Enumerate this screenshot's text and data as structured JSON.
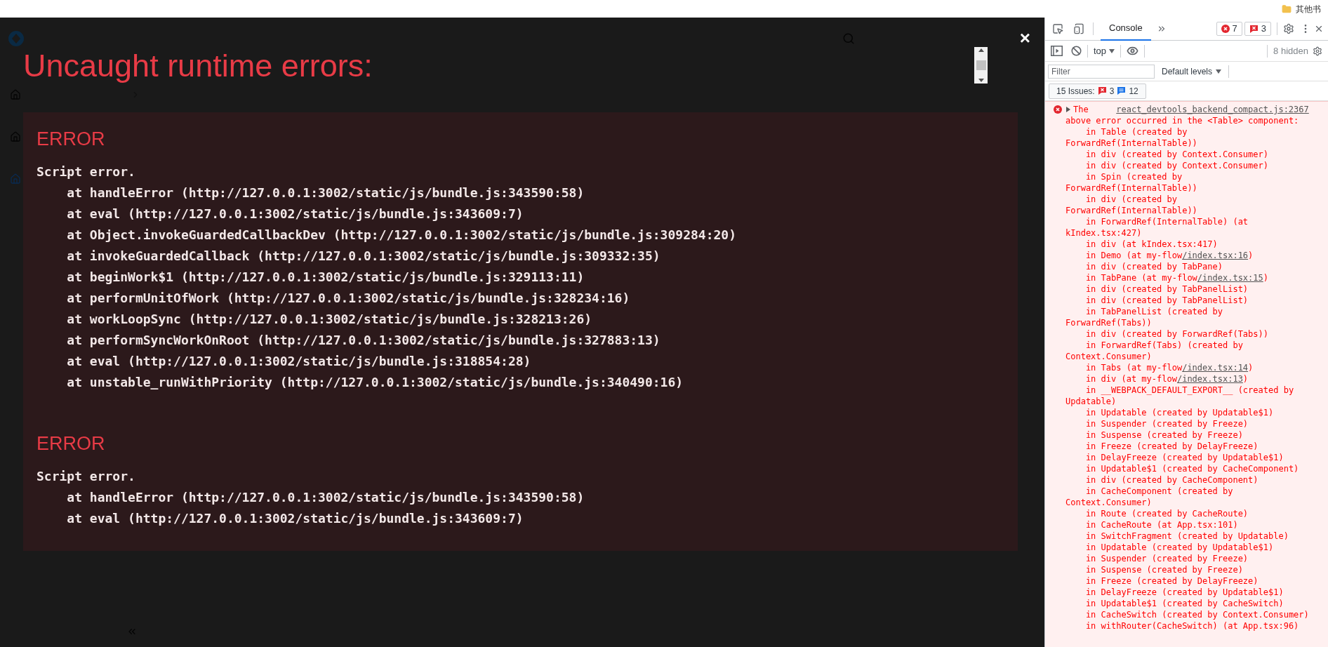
{
  "browser_bar": {
    "bookmark": "其他书"
  },
  "overlay": {
    "title": "Uncaught runtime errors:",
    "close": "×",
    "errors": [
      {
        "heading": "ERROR",
        "message": "Script error.",
        "stack": [
          "at handleError (http://127.0.0.1:3002/static/js/bundle.js:343590:58)",
          "at eval (http://127.0.0.1:3002/static/js/bundle.js:343609:7)",
          "at Object.invokeGuardedCallbackDev (http://127.0.0.1:3002/static/js/bundle.js:309284:20)",
          "at invokeGuardedCallback (http://127.0.0.1:3002/static/js/bundle.js:309332:35)",
          "at beginWork$1 (http://127.0.0.1:3002/static/js/bundle.js:329113:11)",
          "at performUnitOfWork (http://127.0.0.1:3002/static/js/bundle.js:328234:16)",
          "at workLoopSync (http://127.0.0.1:3002/static/js/bundle.js:328213:26)",
          "at performSyncWorkOnRoot (http://127.0.0.1:3002/static/js/bundle.js:327883:13)",
          "at eval (http://127.0.0.1:3002/static/js/bundle.js:318854:28)",
          "at unstable_runWithPriority (http://127.0.0.1:3002/static/js/bundle.js:340490:16)"
        ]
      },
      {
        "heading": "ERROR",
        "message": "Script error.",
        "stack": [
          "at handleError (http://127.0.0.1:3002/static/js/bundle.js:343590:58)",
          "at eval (http://127.0.0.1:3002/static/js/bundle.js:343609:7)"
        ]
      }
    ]
  },
  "devtools": {
    "tabs": [
      {
        "label": "Console",
        "selected": true
      }
    ],
    "error_count": "7",
    "issue_count": "3",
    "context": "top",
    "hidden": "8 hidden",
    "filter_placeholder": "Filter",
    "levels": "Default levels",
    "issues": {
      "label": "15 Issues:",
      "errors": "3",
      "infos": "12"
    },
    "log": {
      "source": "react_devtools_backend_compact.js:2367",
      "message": [
        "The",
        "above error occurred in the <Table> component:"
      ],
      "stack": [
        {
          "text": "in Table (created by ForwardRef(InternalTable))"
        },
        {
          "text": "in div (created by Context.Consumer)"
        },
        {
          "text": "in div (created by Context.Consumer)"
        },
        {
          "text": "in Spin (created by ForwardRef(InternalTable))"
        },
        {
          "text": "in div (created by ForwardRef(InternalTable))"
        },
        {
          "text": "in ForwardRef(InternalTable) (at kIndex.tsx:427)"
        },
        {
          "text": "in div (at kIndex.tsx:417)"
        },
        {
          "text": "in Demo (at my-flow",
          "link": "/index.tsx:16",
          "after": ")"
        },
        {
          "text": "in div (created by TabPane)"
        },
        {
          "text": "in TabPane (at my-flow",
          "link": "/index.tsx:15",
          "after": ")"
        },
        {
          "text": "in div (created by TabPanelList)"
        },
        {
          "text": "in div (created by TabPanelList)"
        },
        {
          "text": "in TabPanelList (created by ForwardRef(Tabs))"
        },
        {
          "text": "in div (created by ForwardRef(Tabs))"
        },
        {
          "text": "in ForwardRef(Tabs) (created by Context.Consumer)"
        },
        {
          "text": "in Tabs (at my-flow",
          "link": "/index.tsx:14",
          "after": ")"
        },
        {
          "text": "in div (at my-flow",
          "link": "/index.tsx:13",
          "after": ")"
        },
        {
          "text": "in __WEBPACK_DEFAULT_EXPORT__ (created by Updatable)"
        },
        {
          "text": "in Updatable (created by Updatable$1)"
        },
        {
          "text": "in Suspender (created by Freeze)"
        },
        {
          "text": "in Suspense (created by Freeze)"
        },
        {
          "text": "in Freeze (created by DelayFreeze)"
        },
        {
          "text": "in DelayFreeze (created by Updatable$1)"
        },
        {
          "text": "in Updatable$1 (created by CacheComponent)"
        },
        {
          "text": "in div (created by CacheComponent)"
        },
        {
          "text": "in CacheComponent (created by Context.Consumer)"
        },
        {
          "text": "in Route (created by CacheRoute)"
        },
        {
          "text": "in CacheRoute (at App.tsx:101)"
        },
        {
          "text": "in SwitchFragment (created by Updatable)"
        },
        {
          "text": "in Updatable (created by Updatable$1)"
        },
        {
          "text": "in Suspender (created by Freeze)"
        },
        {
          "text": "in Suspense (created by Freeze)"
        },
        {
          "text": "in Freeze (created by DelayFreeze)"
        },
        {
          "text": "in DelayFreeze (created by Updatable$1)"
        },
        {
          "text": "in Updatable$1 (created by CacheSwitch)"
        },
        {
          "text": "in CacheSwitch (created by Context.Consumer)"
        },
        {
          "text": "in withRouter(CacheSwitch) (at App.tsx:96)"
        }
      ]
    }
  }
}
